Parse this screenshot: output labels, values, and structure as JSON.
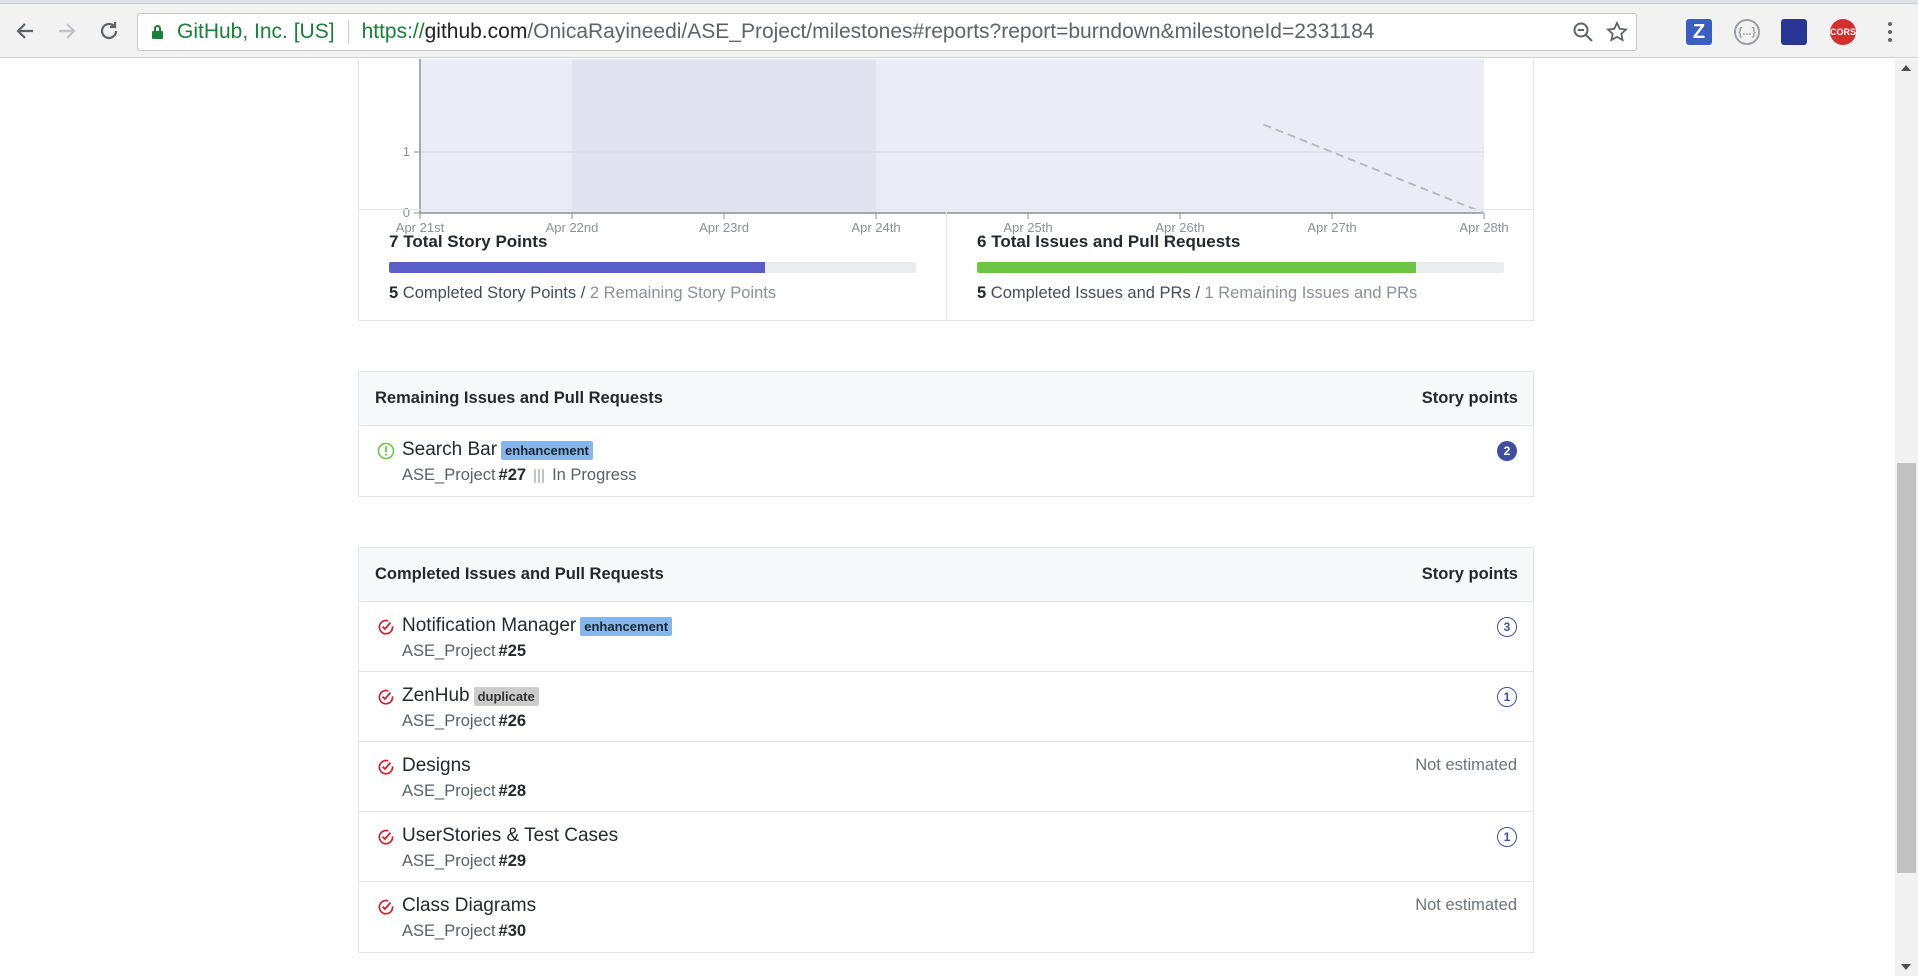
{
  "browser": {
    "site_identity": "GitHub, Inc. [US]",
    "url_scheme": "https://",
    "url_host": "github.com",
    "url_path": "/OnicaRayineedi/ASE_Project/milestones#reports?report=burndown&milestoneId=2331184",
    "extensions": [
      "Z",
      "{...}",
      "",
      "CORS"
    ]
  },
  "chart_data": {
    "type": "line",
    "x": [
      "Apr 21st",
      "Apr 22nd",
      "Apr 23rd",
      "Apr 24th",
      "Apr 25th",
      "Apr 26th",
      "Apr 27th",
      "Apr 28th"
    ],
    "y_ticks_visible": [
      0,
      1
    ],
    "ideal_series_visible": {
      "x": [
        "Apr 27th",
        "Apr 28th"
      ],
      "y": [
        1,
        0
      ]
    },
    "highlight_range": [
      "Apr 22nd",
      "Apr 24th"
    ],
    "grid": true,
    "colors": {
      "plot_bg": "#ececf6",
      "highlight_bg": "#e2e3f1",
      "ideal_line": "#b8bcc8",
      "axis": "#8a8f98"
    }
  },
  "stats": {
    "story_points": {
      "total": "7",
      "title_suffix": "Total Story Points",
      "completed": "5",
      "completed_label": "Completed Story Points",
      "separator": "/",
      "remaining_label": "2 Remaining Story Points",
      "progress": 0.714,
      "color": "#5a5fc7"
    },
    "issues": {
      "total": "6",
      "title_suffix": "Total Issues and Pull Requests",
      "completed": "5",
      "completed_label": "Completed Issues and PRs",
      "separator": "/",
      "remaining_label": "1 Remaining Issues and PRs",
      "progress": 0.833,
      "color": "#6cc644"
    }
  },
  "remaining": {
    "title": "Remaining Issues and Pull Requests",
    "column": "Story points",
    "items": [
      {
        "title": "Search Bar",
        "label": "enhancement",
        "repo": "ASE_Project",
        "number": "#27",
        "pipeline": "In Progress",
        "points": "2"
      }
    ]
  },
  "completed": {
    "title": "Completed Issues and Pull Requests",
    "column": "Story points",
    "items": [
      {
        "title": "Notification Manager",
        "label": "enhancement",
        "repo": "ASE_Project",
        "number": "#25",
        "points": "3"
      },
      {
        "title": "ZenHub",
        "label": "duplicate",
        "repo": "ASE_Project",
        "number": "#26",
        "points": "1"
      },
      {
        "title": "Designs",
        "repo": "ASE_Project",
        "number": "#28",
        "estimate": "Not estimated"
      },
      {
        "title": "UserStories & Test Cases",
        "repo": "ASE_Project",
        "number": "#29",
        "points": "1"
      },
      {
        "title": "Class Diagrams",
        "repo": "ASE_Project",
        "number": "#30",
        "estimate": "Not estimated"
      }
    ]
  }
}
